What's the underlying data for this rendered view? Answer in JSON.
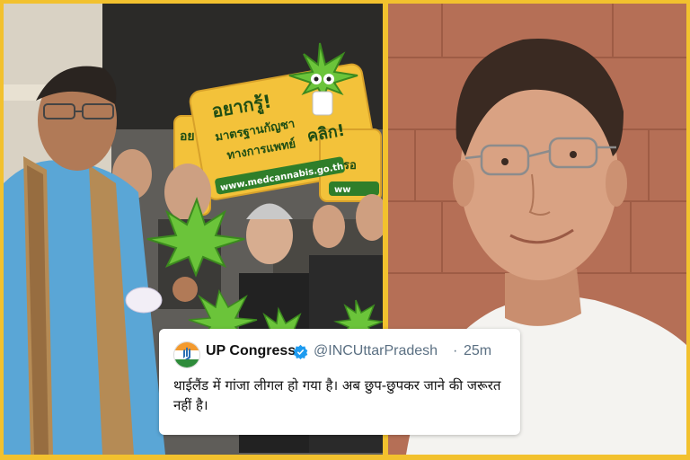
{
  "left_photo": {
    "sign": {
      "headline": "อยากรู้!",
      "line2": "มาตรฐานกัญชา",
      "line3": "ทางการแพทย์",
      "action": "คลิก!",
      "url": "www.medcannabis.go.th",
      "fragment_top": "อย",
      "fragment_right": "รอ",
      "fragment_bottom": "ww"
    }
  },
  "tweet": {
    "name": "UP Congress",
    "handle": "@INCUttarPradesh",
    "separator": "·",
    "time": "25m",
    "text": "थाईलैंड में गांजा लीगल हो गया है। अब छुप-छुपकर जाने की जरूरत नहीं है।",
    "colors": {
      "verified": "#1d9bf0",
      "handle": "#5b7083"
    }
  },
  "colors": {
    "frame": "#f2c12e",
    "sign": "#f3c23a",
    "leaf": "#6bc43a"
  }
}
